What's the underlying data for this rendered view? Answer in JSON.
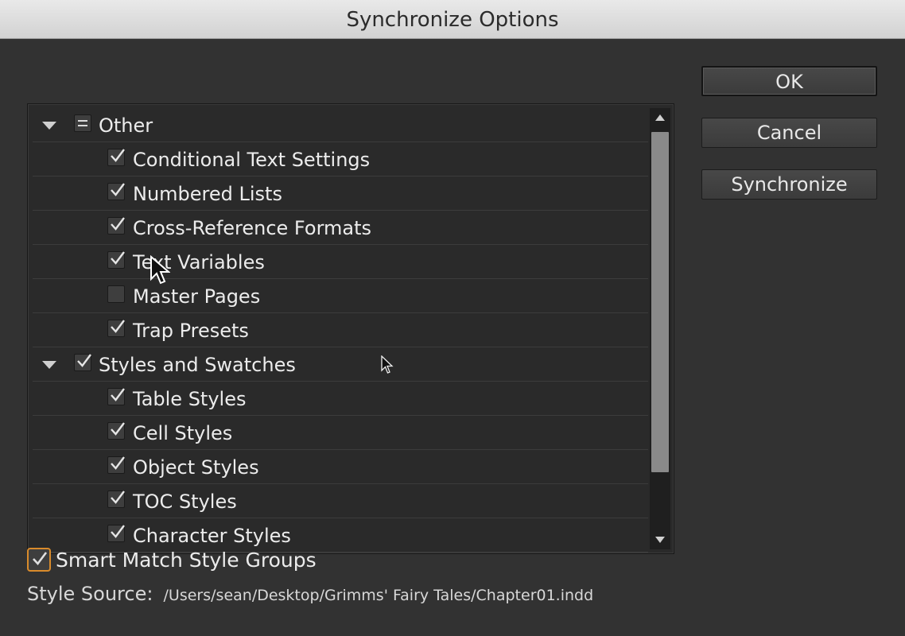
{
  "window": {
    "title": "Synchronize Options"
  },
  "list": {
    "rows": [
      {
        "kind": "group",
        "label": "Other",
        "state": "mixed"
      },
      {
        "kind": "child",
        "label": "Conditional Text Settings",
        "state": "checked"
      },
      {
        "kind": "child",
        "label": "Numbered Lists",
        "state": "checked"
      },
      {
        "kind": "child",
        "label": "Cross-Reference Formats",
        "state": "checked"
      },
      {
        "kind": "child",
        "label": "Text Variables",
        "state": "checked"
      },
      {
        "kind": "child",
        "label": "Master Pages",
        "state": "unchecked"
      },
      {
        "kind": "child",
        "label": "Trap Presets",
        "state": "checked"
      },
      {
        "kind": "group",
        "label": "Styles and Swatches",
        "state": "checked"
      },
      {
        "kind": "child",
        "label": "Table Styles",
        "state": "checked"
      },
      {
        "kind": "child",
        "label": "Cell Styles",
        "state": "checked"
      },
      {
        "kind": "child",
        "label": "Object Styles",
        "state": "checked"
      },
      {
        "kind": "child",
        "label": "TOC Styles",
        "state": "checked"
      },
      {
        "kind": "child",
        "label": "Character Styles",
        "state": "checked"
      }
    ]
  },
  "buttons": {
    "ok": "OK",
    "cancel": "Cancel",
    "synchronize": "Synchronize"
  },
  "options": {
    "smart_match_label": "Smart Match Style Groups",
    "smart_match_checked": true
  },
  "source": {
    "label": "Style Source:",
    "path": "/Users/sean/Desktop/Grimms' Fairy Tales/Chapter01.indd"
  },
  "colors": {
    "accent": "#d98b2b"
  }
}
